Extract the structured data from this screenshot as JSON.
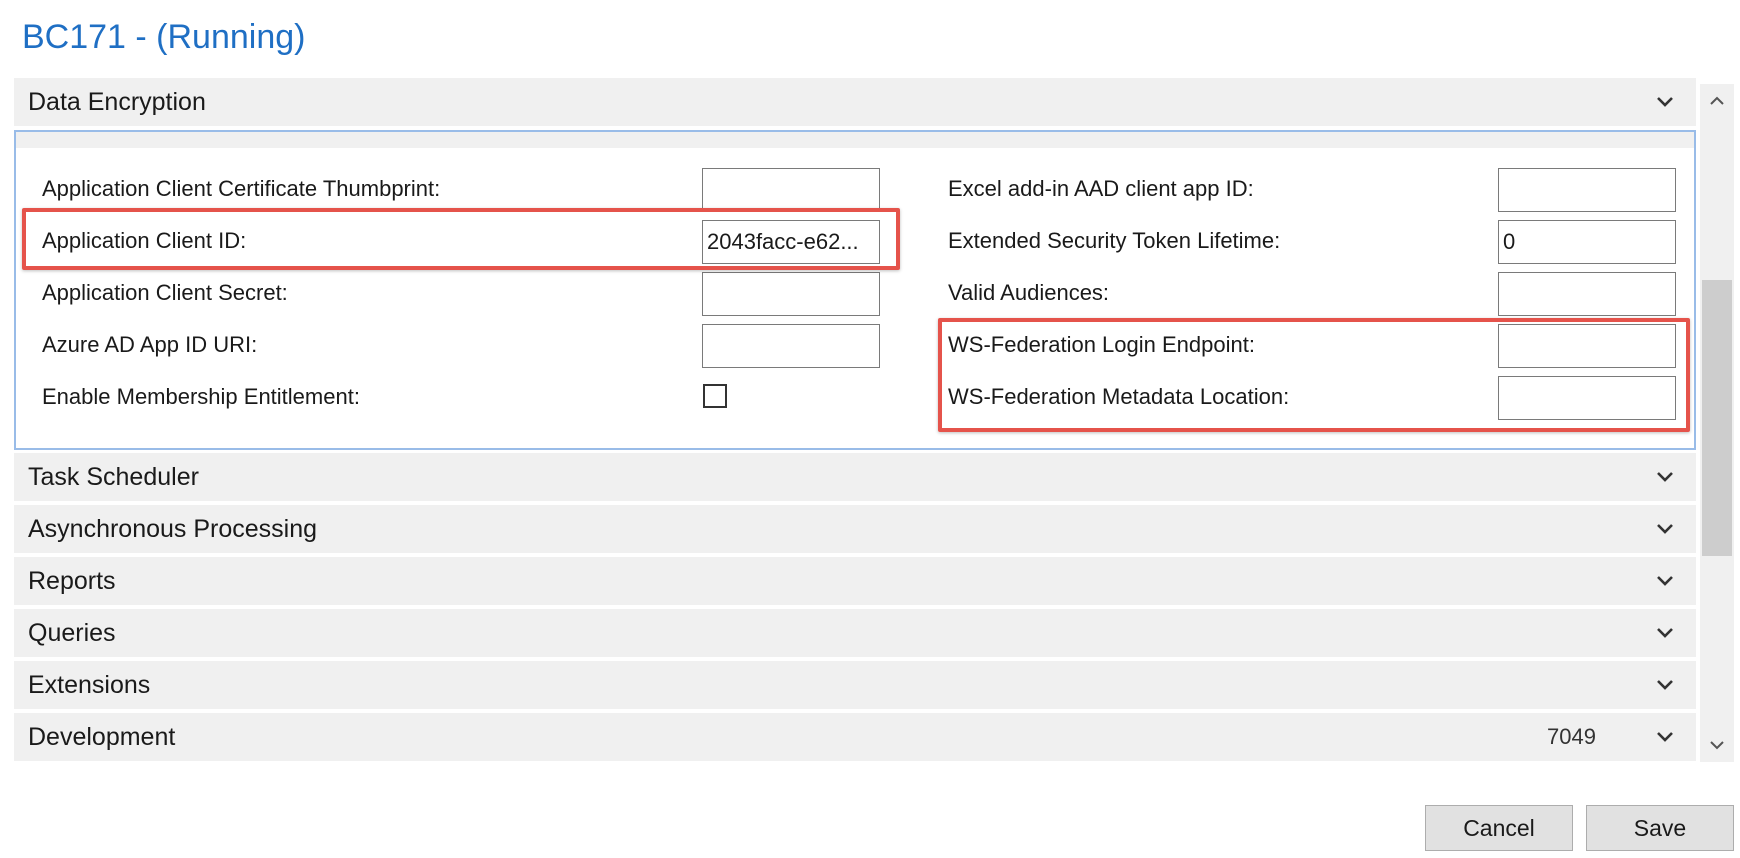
{
  "window": {
    "title": "BC171 - (Running)"
  },
  "sections": {
    "data_encryption": "Data Encryption",
    "task_scheduler": "Task Scheduler",
    "async_processing": "Asynchronous Processing",
    "reports": "Reports",
    "queries": "Queries",
    "extensions": "Extensions",
    "development": "Development",
    "development_value": "7049"
  },
  "left_fields": {
    "cert_thumbprint": {
      "label": "Application Client Certificate Thumbprint:",
      "value": ""
    },
    "client_id": {
      "label": "Application Client ID:",
      "value": "2043facc-e62..."
    },
    "client_secret": {
      "label": "Application Client Secret:",
      "value": ""
    },
    "app_id_uri": {
      "label": "Azure AD App ID URI:",
      "value": ""
    },
    "membership": {
      "label": "Enable Membership Entitlement:",
      "checked": false
    }
  },
  "right_fields": {
    "excel_app_id": {
      "label": "Excel add-in AAD client app ID:",
      "value": ""
    },
    "token_lifetime": {
      "label": "Extended Security Token Lifetime:",
      "value": "0"
    },
    "valid_audiences": {
      "label": "Valid Audiences:",
      "value": ""
    },
    "wsfed_login": {
      "label": "WS-Federation Login Endpoint:",
      "value": ""
    },
    "wsfed_metadata": {
      "label": "WS-Federation Metadata Location:",
      "value": ""
    }
  },
  "buttons": {
    "cancel": "Cancel",
    "save": "Save"
  },
  "icons": {
    "section_toggle": "chevron-down-icon",
    "scroll_up": "scroll-up-arrow-icon",
    "scroll_down": "scroll-down-arrow-icon"
  },
  "colors": {
    "title": "#1f6fc4",
    "highlight": "#e5534b",
    "panel_border": "#99bce8"
  }
}
